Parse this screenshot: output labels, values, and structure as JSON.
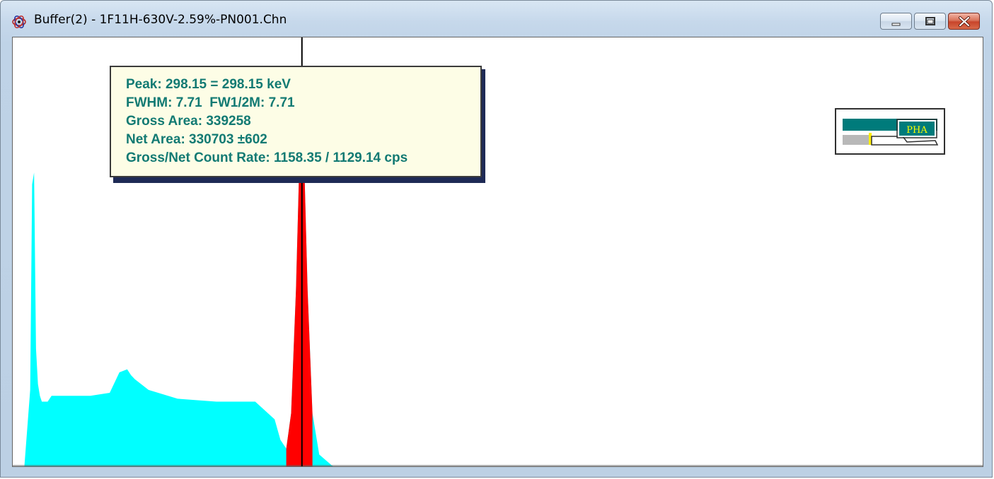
{
  "window": {
    "title": "Buffer(2) - 1F11H-630V-2.59%-PN001.Chn",
    "minimize_label": "minimize",
    "maximize_label": "maximize",
    "close_label": "close"
  },
  "peak_info": {
    "line1": "Peak: 298.15 = 298.15 keV",
    "line2": "FWHM: 7.71  FW1/2M: 7.71",
    "line3": "Gross Area: 339258",
    "line4": "Net Area: 330703 ±602",
    "line5": "Gross/Net Count Rate: 1158.35 / 1129.14 cps"
  },
  "mode_indicator": {
    "label": "PHA"
  },
  "colors": {
    "spectrum_fill": "#00ffff",
    "roi_fill": "#ff0000",
    "cursor": "#000000",
    "tooltip_text": "#127a73",
    "tooltip_bg": "#fdfde6",
    "pha_bar": "#007b7b",
    "pha_text": "#ffff00",
    "pha_label_bg": "#007b7b"
  },
  "chart_data": {
    "type": "area",
    "title": "",
    "xlabel": "",
    "ylabel": "",
    "x_unit": "keV",
    "cursor_x": 298.15,
    "series": [
      {
        "role": "spectrum",
        "x": [
          0,
          12,
          18,
          20,
          22,
          24,
          26,
          28,
          30,
          36,
          40,
          60,
          80,
          100,
          110,
          118,
          122,
          126,
          140,
          170,
          210,
          250,
          270,
          276,
          282,
          287,
          292,
          296,
          298.15,
          300,
          304,
          309,
          316,
          330,
          400,
          700,
          1000
        ],
        "y": [
          0,
          0,
          130,
          480,
          500,
          200,
          140,
          120,
          110,
          110,
          120,
          120,
          120,
          125,
          160,
          165,
          155,
          148,
          130,
          115,
          110,
          110,
          80,
          45,
          30,
          90,
          300,
          550,
          720,
          550,
          300,
          90,
          20,
          0,
          0,
          0,
          0
        ]
      }
    ],
    "roi": {
      "from": 282,
      "to": 309
    },
    "xlim": [
      0,
      1000
    ],
    "ylim": [
      0,
      730
    ]
  }
}
